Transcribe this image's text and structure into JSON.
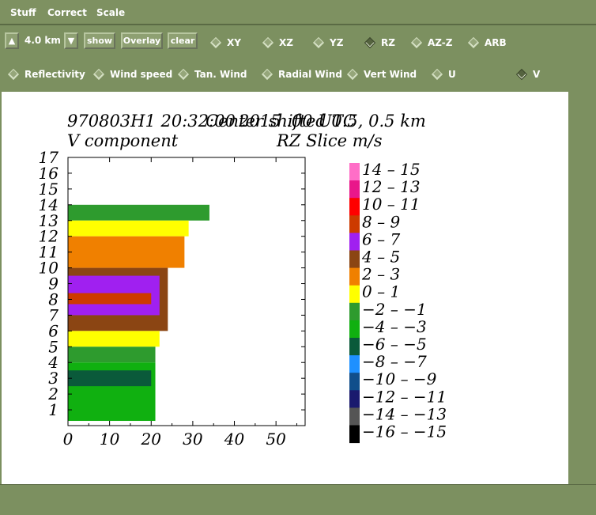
{
  "menu": {
    "items": [
      "Stuff",
      "Correct",
      "Scale"
    ]
  },
  "toolbar": {
    "height_value": "4.0 km",
    "up_icon": "▲",
    "down_icon": "▼",
    "show_label": "show",
    "overlay_label": "Overlay",
    "clear_label": "clear",
    "views": [
      "XY",
      "XZ",
      "YZ",
      "RZ",
      "AZ-Z",
      "ARB"
    ],
    "selected_view": "RZ",
    "fields": [
      "Reflectivity",
      "Wind speed",
      "Tan. Wind",
      "Radial Wind",
      "Vert Wind",
      "U",
      "V"
    ],
    "selected_field": "V"
  },
  "plot": {
    "title_left": "970803H1  20:32:00",
    "title_overlap": "Center shifted 0.5,  0.5 km",
    "title_right": "2015 .00 UTC",
    "subtitle_left": "V component",
    "subtitle_right": "RZ Slice  m/s"
  },
  "chart_data": {
    "type": "heatmap",
    "title": "970803H1  20:32:00",
    "subtitle": "V component",
    "xlabel": "",
    "ylabel": "",
    "units": "m/s",
    "xlim": [
      0,
      57
    ],
    "ylim": [
      0,
      17
    ],
    "x_ticks": [
      0,
      10,
      20,
      30,
      40,
      50
    ],
    "y_ticks": [
      1,
      2,
      3,
      4,
      5,
      6,
      7,
      8,
      9,
      10,
      11,
      12,
      13,
      14,
      15,
      16,
      17
    ],
    "legend_position": "right",
    "legend": [
      {
        "label": "14 – 15",
        "color": "#ff6ec7"
      },
      {
        "label": "12 – 13",
        "color": "#e9178a"
      },
      {
        "label": "10 – 11",
        "color": "#ff0000"
      },
      {
        "label": "8 – 9",
        "color": "#cd3a00"
      },
      {
        "label": "6 – 7",
        "color": "#a020f0"
      },
      {
        "label": "4 – 5",
        "color": "#8b4513"
      },
      {
        "label": "2 – 3",
        "color": "#f08000"
      },
      {
        "label": "0 – 1",
        "color": "#ffff00"
      },
      {
        "label": "−2 – −1",
        "color": "#2e9b2e"
      },
      {
        "label": "−4 – −3",
        "color": "#10b010"
      },
      {
        "label": "−6 – −5",
        "color": "#0a5a3a"
      },
      {
        "label": "−8 – −7",
        "color": "#1e90ff"
      },
      {
        "label": "−10 – −9",
        "color": "#104e8b"
      },
      {
        "label": "−12 – −11",
        "color": "#1a1a6e"
      },
      {
        "label": "−14 – −13",
        "color": "#555555"
      },
      {
        "label": "−16 – −15",
        "color": "#000000"
      }
    ],
    "bands": [
      {
        "z": [
          13,
          14
        ],
        "x": [
          0,
          34
        ],
        "value_range": "−2 – −1"
      },
      {
        "z": [
          12,
          13
        ],
        "x": [
          0,
          29
        ],
        "value_range": "0 – 1"
      },
      {
        "z": [
          10,
          12
        ],
        "x": [
          0,
          28
        ],
        "value_range": "2 – 3"
      },
      {
        "z": [
          6,
          10
        ],
        "x": [
          0,
          24
        ],
        "value_range": "4 – 5"
      },
      {
        "z": [
          7,
          9.5
        ],
        "x": [
          0,
          22
        ],
        "value_range": "6 – 7"
      },
      {
        "z": [
          7.7,
          8.4
        ],
        "x": [
          0,
          20
        ],
        "value_range": "8 – 9"
      },
      {
        "z": [
          5,
          6
        ],
        "x": [
          0,
          22
        ],
        "value_range": "0 – 1"
      },
      {
        "z": [
          4,
          5
        ],
        "x": [
          0,
          21
        ],
        "value_range": "−2 – −1"
      },
      {
        "z": [
          0.3,
          4
        ],
        "x": [
          0,
          21
        ],
        "value_range": "−4 – −3"
      },
      {
        "z": [
          2.5,
          3.5
        ],
        "x": [
          0,
          20
        ],
        "value_range": "−6 – −5"
      }
    ]
  }
}
